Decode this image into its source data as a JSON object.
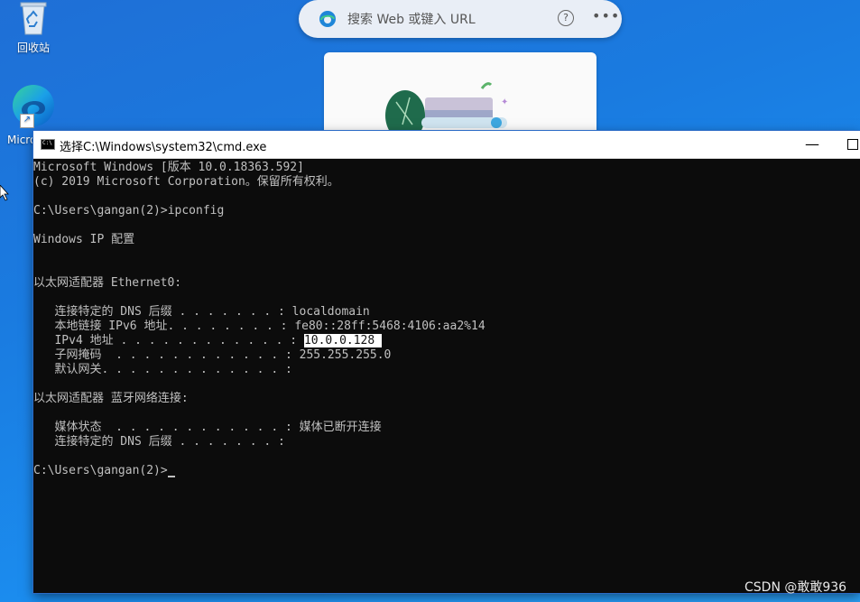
{
  "desktop": {
    "recycle_label": "回收站",
    "edge_label": "Micro Ed"
  },
  "browser": {
    "search_placeholder": "搜索 Web 或键入 URL",
    "help_icon": "?",
    "more_icon": "•••"
  },
  "cmd": {
    "title": "选择C:\\Windows\\system32\\cmd.exe",
    "minimize": "—",
    "lines": [
      "Microsoft Windows [版本 10.0.18363.592]",
      "(c) 2019 Microsoft Corporation。保留所有权利。",
      "",
      "C:\\Users\\gangan(2)>ipconfig",
      "",
      "Windows IP 配置",
      "",
      "",
      "以太网适配器 Ethernet0:",
      "",
      "   连接特定的 DNS 后缀 . . . . . . . : localdomain",
      "   本地链接 IPv6 地址. . . . . . . . : fe80::28ff:5468:4106:aa2%14",
      "   IPv4 地址 . . . . . . . . . . . . : ",
      "   子网掩码  . . . . . . . . . . . . : 255.255.255.0",
      "   默认网关. . . . . . . . . . . . . : ",
      "",
      "以太网适配器 蓝牙网络连接:",
      "",
      "   媒体状态  . . . . . . . . . . . . : 媒体已断开连接",
      "   连接特定的 DNS 后缀 . . . . . . . : ",
      "",
      "C:\\Users\\gangan(2)>"
    ],
    "ipv4_value": "10.0.0.128 "
  },
  "watermark": "CSDN @敢敢936"
}
